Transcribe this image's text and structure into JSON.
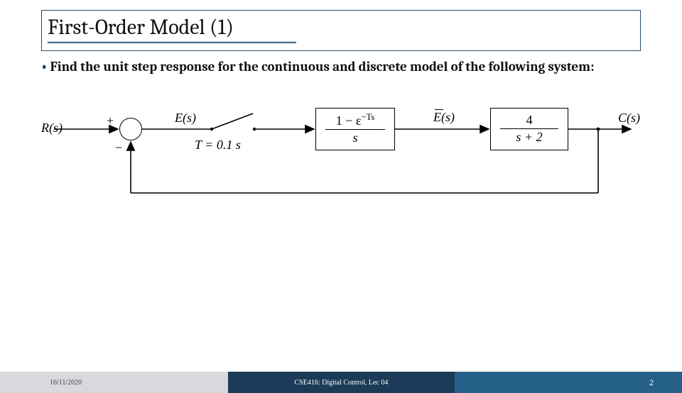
{
  "title": "First-Order Model (1)",
  "bullet_text": "Find the unit step response for the continuous and discrete model of the following system:",
  "diagram": {
    "R": "R(s)",
    "plus": "+",
    "minus": "−",
    "E": "E(s)",
    "T": "T = 0.1 s",
    "zoh_num": "1 − ε<sup>−Ts</sup>",
    "zoh_den": "s",
    "Ebar": "E(s)",
    "plant_num": "4",
    "plant_den": "s + 2",
    "C": "C(s)"
  },
  "footer": {
    "date": "16/11/2020",
    "center": "CSE416: Digital Control, Lec 04",
    "page": "2"
  }
}
